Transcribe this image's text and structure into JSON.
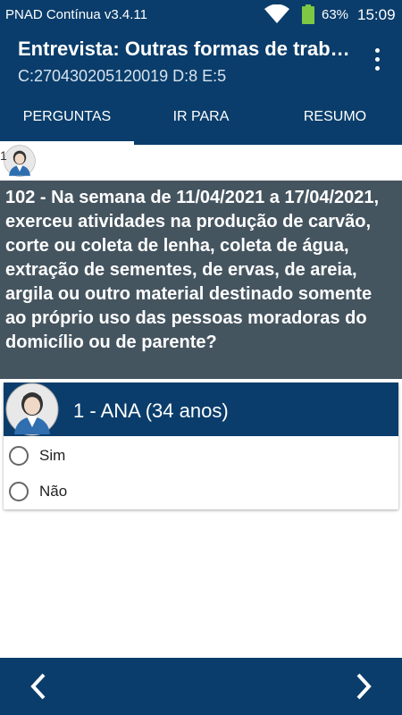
{
  "status_bar": {
    "app_name": "PNAD Contínua v3.4.11",
    "battery": "63%",
    "time": "15:09"
  },
  "app_bar": {
    "title": "Entrevista: Outras formas de trabalho",
    "subtitle": "C:270430205120019 D:8 E:5",
    "menu_icon": "more-vert-icon"
  },
  "tabs": [
    {
      "label": "PERGUNTAS",
      "active": true
    },
    {
      "label": "IR PARA",
      "active": false
    },
    {
      "label": "RESUMO",
      "active": false
    }
  ],
  "respondent_chip": {
    "number": "1"
  },
  "question": {
    "text": "102 - Na semana de 11/04/2021 a 17/04/2021, exerceu atividades na produção de carvão, corte ou coleta de lenha, coleta de água, extração de sementes, de ervas, de areia, argila ou outro material destinado somente ao próprio uso das pessoas moradoras do domicílio ou de parente?"
  },
  "person_card": {
    "name": "1 - ANA (34 anos)",
    "options": [
      {
        "label": "Sim",
        "selected": false
      },
      {
        "label": "Não",
        "selected": false
      }
    ]
  },
  "bottom_nav": {
    "prev_icon": "chevron-left-icon",
    "next_icon": "chevron-right-icon"
  },
  "colors": {
    "primary": "#0a3d6b",
    "question_bg": "#455560"
  }
}
